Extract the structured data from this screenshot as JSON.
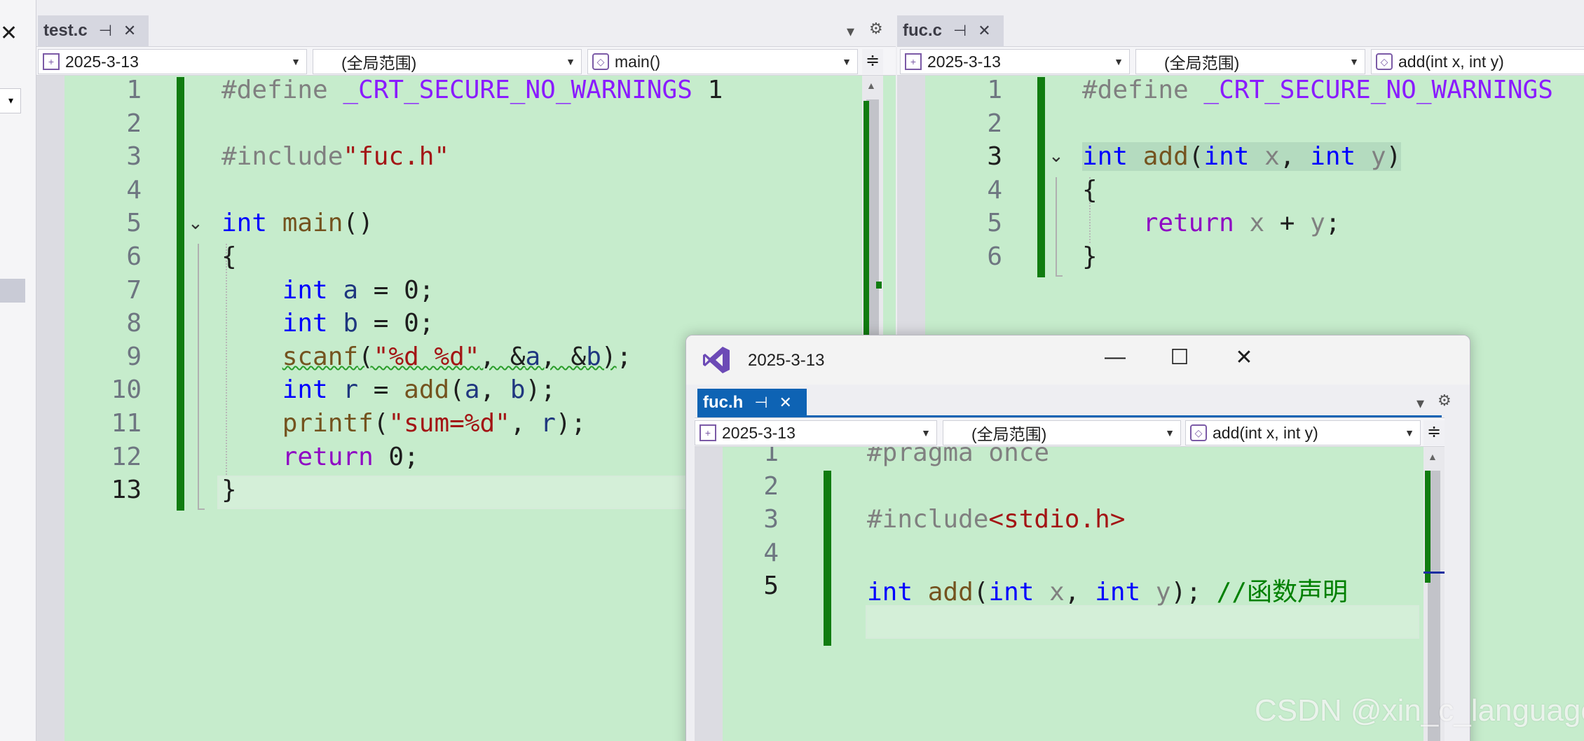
{
  "left_panel": {
    "close_glyph": "✕",
    "dropdown_glyph": "▾"
  },
  "groups": [
    {
      "tab": {
        "label": "test.c",
        "pin": "⊣",
        "close": "✕"
      },
      "nav": {
        "project": "2025-3-13",
        "scope": "(全局范围)",
        "member": "main()"
      },
      "lines": [
        {
          "n": "1",
          "tokens": [
            [
              "pp",
              "#define "
            ],
            [
              "mac",
              "_CRT_SECURE_NO_WARNINGS"
            ],
            [
              "",
              " 1"
            ]
          ]
        },
        {
          "n": "2",
          "tokens": []
        },
        {
          "n": "3",
          "tokens": [
            [
              "pp",
              "#include"
            ],
            [
              "str",
              "\"fuc.h\""
            ]
          ]
        },
        {
          "n": "4",
          "tokens": []
        },
        {
          "n": "5",
          "tokens": [
            [
              "kw",
              "int"
            ],
            [
              "",
              " "
            ],
            [
              "fn",
              "main"
            ],
            [
              "",
              "()"
            ]
          ]
        },
        {
          "n": "6",
          "tokens": [
            [
              "",
              "{"
            ]
          ]
        },
        {
          "n": "7",
          "tokens": [
            [
              "",
              "    "
            ],
            [
              "kw",
              "int"
            ],
            [
              "",
              " "
            ],
            [
              "var",
              "a"
            ],
            [
              "",
              " = 0;"
            ]
          ]
        },
        {
          "n": "8",
          "tokens": [
            [
              "",
              "    "
            ],
            [
              "kw",
              "int"
            ],
            [
              "",
              " "
            ],
            [
              "var",
              "b"
            ],
            [
              "",
              " = 0;"
            ]
          ]
        },
        {
          "n": "9",
          "tokens": [
            [
              "",
              "    "
            ],
            [
              "fn squig",
              "scanf"
            ],
            [
              "squig",
              "("
            ],
            [
              "str squig",
              "\"%d %d\""
            ],
            [
              "squig",
              ", &"
            ],
            [
              "var squig",
              "a"
            ],
            [
              "squig",
              ", &"
            ],
            [
              "var squig",
              "b"
            ],
            [
              "squig",
              ")"
            ],
            [
              "",
              ";"
            ]
          ]
        },
        {
          "n": "10",
          "tokens": [
            [
              "",
              "    "
            ],
            [
              "kw",
              "int"
            ],
            [
              "",
              " "
            ],
            [
              "var",
              "r"
            ],
            [
              "",
              " = "
            ],
            [
              "fn",
              "add"
            ],
            [
              "",
              "("
            ],
            [
              "var",
              "a"
            ],
            [
              "",
              ", "
            ],
            [
              "var",
              "b"
            ],
            [
              "",
              ");"
            ]
          ]
        },
        {
          "n": "11",
          "tokens": [
            [
              "",
              "    "
            ],
            [
              "fn",
              "printf"
            ],
            [
              "",
              "("
            ],
            [
              "str",
              "\"sum=%d\""
            ],
            [
              "",
              ", "
            ],
            [
              "var",
              "r"
            ],
            [
              "",
              ");"
            ]
          ]
        },
        {
          "n": "12",
          "tokens": [
            [
              "",
              "    "
            ],
            [
              "kw2",
              "return"
            ],
            [
              "",
              " 0;"
            ]
          ]
        },
        {
          "n": "13",
          "tokens": [
            [
              "",
              "}"
            ]
          ]
        }
      ]
    },
    {
      "tab": {
        "label": "fuc.c",
        "pin": "⊣",
        "close": "✕"
      },
      "nav": {
        "project": "2025-3-13",
        "scope": "(全局范围)",
        "member": "add(int x, int y)"
      },
      "lines": [
        {
          "n": "1",
          "tokens": [
            [
              "pp",
              "#define "
            ],
            [
              "mac",
              "_CRT_SECURE_NO_WARNINGS"
            ]
          ]
        },
        {
          "n": "2",
          "tokens": []
        },
        {
          "n": "3",
          "tokens": [
            [
              "kw hl",
              "int"
            ],
            [
              "hl",
              " "
            ],
            [
              "fn hl",
              "add"
            ],
            [
              "hl",
              "("
            ],
            [
              "kw hl",
              "int"
            ],
            [
              "hl",
              " "
            ],
            [
              "par hl",
              "x"
            ],
            [
              "hl",
              ", "
            ],
            [
              "kw hl",
              "int"
            ],
            [
              "hl",
              " "
            ],
            [
              "par hl",
              "y"
            ],
            [
              "hl",
              ")"
            ]
          ]
        },
        {
          "n": "4",
          "tokens": [
            [
              "",
              "{"
            ]
          ]
        },
        {
          "n": "5",
          "tokens": [
            [
              "",
              "    "
            ],
            [
              "kw2",
              "return"
            ],
            [
              "",
              " "
            ],
            [
              "par",
              "x"
            ],
            [
              "",
              " + "
            ],
            [
              "par",
              "y"
            ],
            [
              "",
              ";"
            ]
          ]
        },
        {
          "n": "6",
          "tokens": [
            [
              "",
              "}"
            ]
          ]
        }
      ]
    }
  ],
  "float_window": {
    "title": "2025-3-13",
    "buttons": {
      "minimize": "—",
      "maximize": "☐",
      "close": "✕"
    },
    "tab": {
      "label": "fuc.h",
      "pin": "⊣",
      "close": "✕"
    },
    "nav": {
      "project": "2025-3-13",
      "scope": "(全局范围)",
      "member": "add(int x, int y)"
    },
    "lines": [
      {
        "n": "1",
        "tokens": [
          [
            "pp",
            "#pragma once"
          ]
        ]
      },
      {
        "n": "2",
        "tokens": []
      },
      {
        "n": "3",
        "tokens": [
          [
            "pp",
            "#include"
          ],
          [
            "str",
            "<stdio.h>"
          ]
        ]
      },
      {
        "n": "4",
        "tokens": []
      },
      {
        "n": "5",
        "tokens": [
          [
            "kw",
            "int"
          ],
          [
            "",
            " "
          ],
          [
            "fn",
            "add"
          ],
          [
            "",
            "("
          ],
          [
            "kw",
            "int"
          ],
          [
            "",
            " "
          ],
          [
            "par",
            "x"
          ],
          [
            "",
            ", "
          ],
          [
            "kw",
            "int"
          ],
          [
            "",
            " "
          ],
          [
            "par",
            "y"
          ],
          [
            "",
            "); "
          ],
          [
            "cmt",
            "//函数声明"
          ]
        ]
      }
    ]
  },
  "watermark": "CSDN @xin_c_language",
  "colors": {
    "editor_bg": "#c6eccc",
    "change_bar": "#107c10",
    "active_tab": "#0e63b4"
  }
}
